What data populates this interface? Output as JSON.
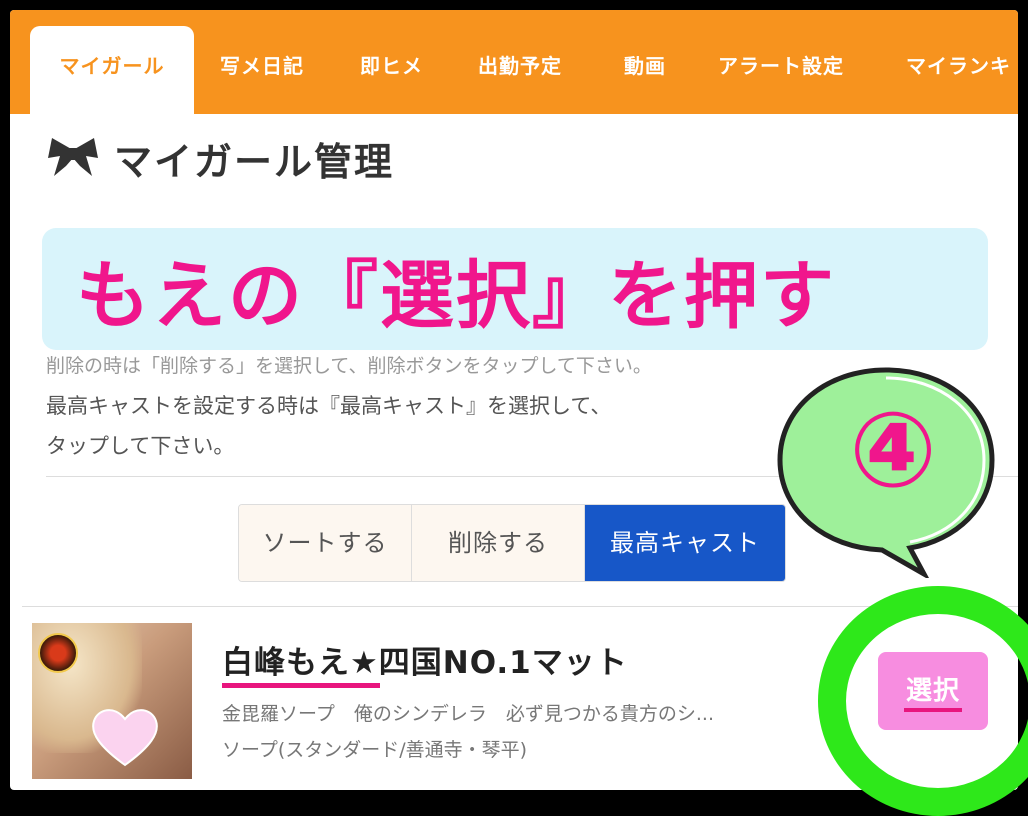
{
  "tabs": [
    {
      "label": "マイガール",
      "active": true
    },
    {
      "label": "写メ日記"
    },
    {
      "label": "即ヒメ"
    },
    {
      "label": "出勤予定"
    },
    {
      "label": "動画"
    },
    {
      "label": "アラート設定"
    },
    {
      "label": "マイランキ"
    }
  ],
  "page": {
    "title": "マイガール管理",
    "title_icon": "ribbon-icon"
  },
  "banner": {
    "text": "もえの『選択』を押す"
  },
  "instructions": {
    "line0": "削除の時は「削除する」を選択して、削除ボタンをタップして下さい。",
    "line1": "最高キャストを設定する時は『最高キャスト』を選択して、",
    "line2": "タップして下さい。"
  },
  "actions": {
    "sort_label": "ソートする",
    "delete_label": "削除する",
    "best_cast_label": "最高キャスト"
  },
  "cast_item": {
    "name": "白峰もえ★四国NO.1マット",
    "shop": "金毘羅ソープ　俺のシンデレラ　必ず見つかる貴方のシ...",
    "genre": "ソープ(スタンダード/善通寺・琴平)",
    "select_label": "選択"
  },
  "callout": {
    "number": "④"
  },
  "colors": {
    "accent": "#f7931e",
    "banner_text": "#f0168c",
    "banner_bg": "#d9f4fb",
    "primary_button": "#1757c8",
    "select_button": "#f78de0",
    "highlight_ring": "#2ee81a",
    "bubble": "#9ef09a"
  }
}
